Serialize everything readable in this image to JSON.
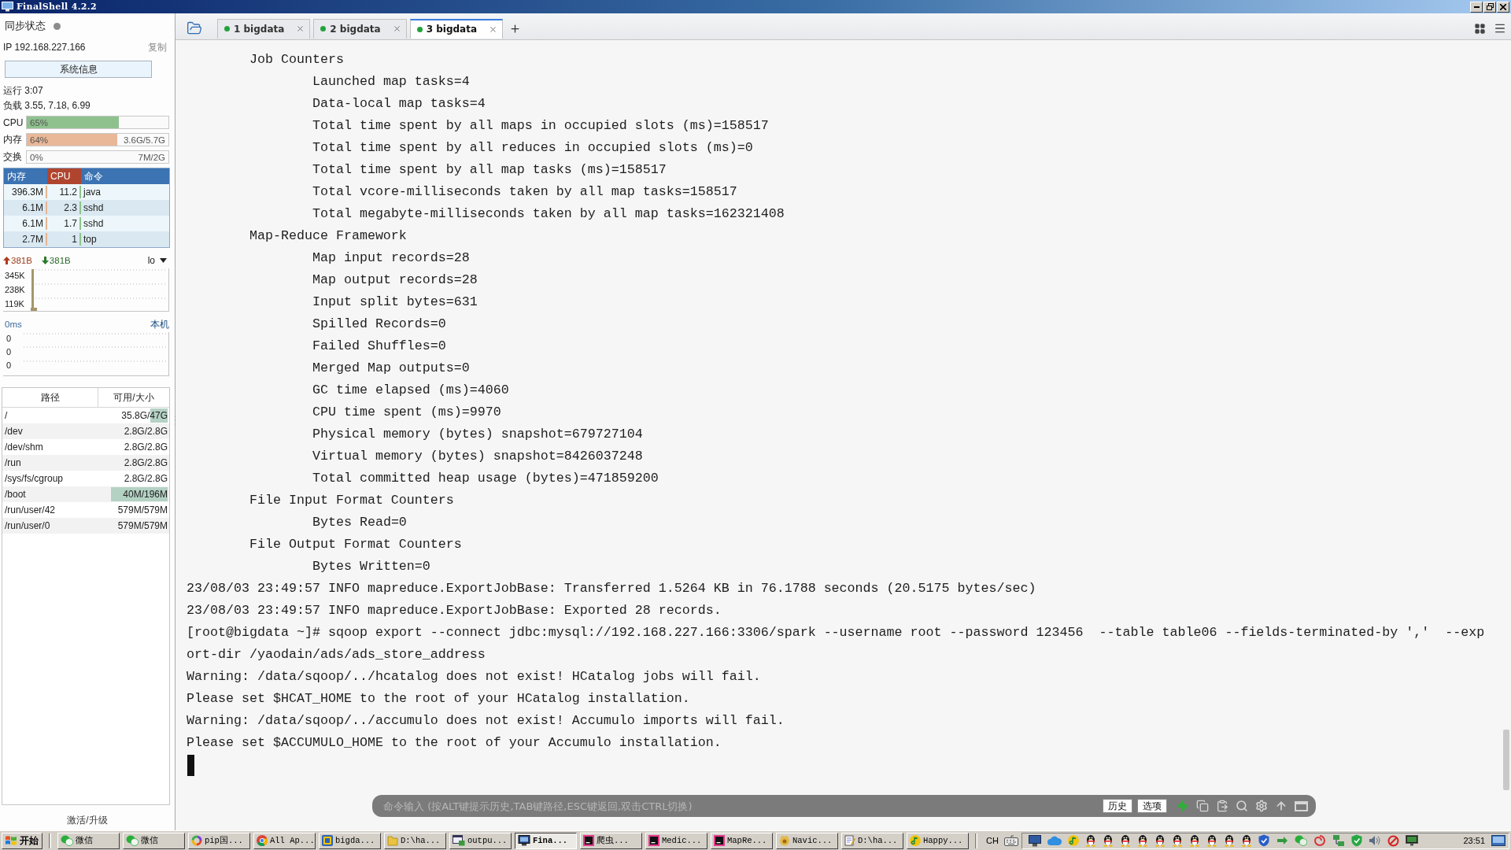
{
  "window": {
    "title": "FinalShell 4.2.2"
  },
  "sidebar": {
    "sync_status": "同步状态",
    "ip": "IP 192.168.227.166",
    "copy_button": "复制",
    "system_info_button": "系统信息",
    "uptime": "运行 3:07",
    "load": "负载 3.55, 7.18, 6.99",
    "meters": [
      {
        "label": "CPU",
        "level": 0.65,
        "percent": "65%",
        "color": "#8fc18f"
      },
      {
        "label": "内存",
        "level": 0.64,
        "percent": "64%",
        "amount": "3.6G/5.7G",
        "color": "#e9b898"
      },
      {
        "label": "交换",
        "percent": "0%",
        "amount": "7M/2G"
      }
    ],
    "processes": {
      "columns": [
        {
          "label": "内存",
          "selected": false
        },
        {
          "label": "CPU",
          "selected": true
        },
        {
          "label": "命令",
          "selected": false
        }
      ],
      "rows": [
        {
          "memory": "396.3M",
          "cpu": "11.2",
          "command": "java"
        },
        {
          "memory": "6.1M",
          "cpu": "2.3",
          "command": "sshd"
        },
        {
          "memory": "6.1M",
          "cpu": "1.7",
          "command": "sshd"
        },
        {
          "memory": "2.7M",
          "cpu": "1",
          "command": "top"
        }
      ]
    },
    "network": {
      "upload": "381B",
      "download": "381B",
      "interface": "lo",
      "scale": [
        "345K",
        "238K",
        "119K"
      ]
    },
    "ping": {
      "latency": "0ms",
      "host": "本机",
      "scale": [
        "0",
        "0",
        "0"
      ]
    },
    "disks": {
      "columns": [
        "路径",
        "可用/大小"
      ],
      "rows": [
        {
          "path": "/",
          "space": "35.8G/47G",
          "level": 0.24
        },
        {
          "path": "/dev",
          "space": "2.8G/2.8G"
        },
        {
          "path": "/dev/shm",
          "space": "2.8G/2.8G"
        },
        {
          "path": "/run",
          "space": "2.8G/2.8G"
        },
        {
          "path": "/sys/fs/cgroup",
          "space": "2.8G/2.8G"
        },
        {
          "path": "/boot",
          "space": "40M/196M",
          "level": 0.8
        },
        {
          "path": "/run/user/42",
          "space": "579M/579M"
        },
        {
          "path": "/run/user/0",
          "space": "579M/579M"
        }
      ]
    },
    "upgrade_link": "激活/升级"
  },
  "tabs": [
    {
      "label": "1 bigdata",
      "selected": false
    },
    {
      "label": "2 bigdata",
      "selected": false
    },
    {
      "label": "3 bigdata",
      "selected": true
    }
  ],
  "terminal": {
    "counter_groups": [
      {
        "name": "Job Counters",
        "counters": [
          "Launched map tasks=4",
          "Data-local map tasks=4",
          "Total time spent by all maps in occupied slots (ms)=158517",
          "Total time spent by all reduces in occupied slots (ms)=0",
          "Total time spent by all map tasks (ms)=158517",
          "Total vcore-milliseconds taken by all map tasks=158517",
          "Total megabyte-milliseconds taken by all map tasks=162321408"
        ]
      },
      {
        "name": "Map-Reduce Framework",
        "counters": [
          "Map input records=28",
          "Map output records=28",
          "Input split bytes=631",
          "Spilled Records=0",
          "Failed Shuffles=0",
          "Merged Map outputs=0",
          "GC time elapsed (ms)=4060",
          "CPU time spent (ms)=9970",
          "Physical memory (bytes) snapshot=679727104",
          "Virtual memory (bytes) snapshot=8426037248",
          "Total committed heap usage (bytes)=471859200"
        ]
      },
      {
        "name": "File Input Format Counters",
        "counters": [
          "Bytes Read=0"
        ]
      },
      {
        "name": "File Output Format Counters",
        "counters": [
          "Bytes Written=0"
        ]
      }
    ],
    "lines": [
      "23/08/03 23:49:57 INFO mapreduce.ExportJobBase: Transferred 1.5264 KB in 76.1788 seconds (20.5175 bytes/sec)",
      "23/08/03 23:49:57 INFO mapreduce.ExportJobBase: Exported 28 records.",
      "[root@bigdata ~]# sqoop export --connect jdbc:mysql://192.168.227.166:3306/spark --username root --password 123456  --table table06 --fields-terminated-by ','  --exp",
      "ort-dir /yaodain/ads/ads_store_address",
      "Warning: /data/sqoop/../hcatalog does not exist! HCatalog jobs will fail.",
      "Please set $HCAT_HOME to the root of your HCatalog installation.",
      "Warning: /data/sqoop/../accumulo does not exist! Accumulo imports will fail.",
      "Please set $ACCUMULO_HOME to the root of your Accumulo installation."
    ]
  },
  "command_bar": {
    "placeholder": "命令输入 (按ALT键提示历史,TAB键路径,ESC键返回,双击CTRL切换)",
    "buttons": [
      "历史",
      "选项"
    ]
  },
  "taskbar": {
    "start": "开始",
    "tasks": [
      {
        "label": "微信",
        "kind": "chat",
        "selected": false
      },
      {
        "label": "微信",
        "kind": "chat",
        "selected": false
      },
      {
        "label": "pip国...",
        "kind": "ring",
        "selected": false
      },
      {
        "label": "All Ap...",
        "kind": "browser",
        "selected": false
      },
      {
        "label": "bigda...",
        "kind": "box",
        "selected": false
      },
      {
        "label": "D:\\ha...",
        "kind": "folder",
        "selected": false
      },
      {
        "label": "outpu...",
        "kind": "window",
        "selected": false
      },
      {
        "label": "Fina...",
        "kind": "monitor",
        "selected": true
      },
      {
        "label": "爬虫...",
        "kind": "ide",
        "selected": false
      },
      {
        "label": "Medic...",
        "kind": "ide",
        "selected": false
      },
      {
        "label": "MapRe...",
        "kind": "ide",
        "selected": false
      },
      {
        "label": "Navic...",
        "kind": "db",
        "selected": false
      },
      {
        "label": "D:\\ha...",
        "kind": "notepad",
        "selected": false
      },
      {
        "label": "Happy...",
        "kind": "music",
        "selected": false
      }
    ],
    "language": "CH",
    "clock": "23:51"
  }
}
